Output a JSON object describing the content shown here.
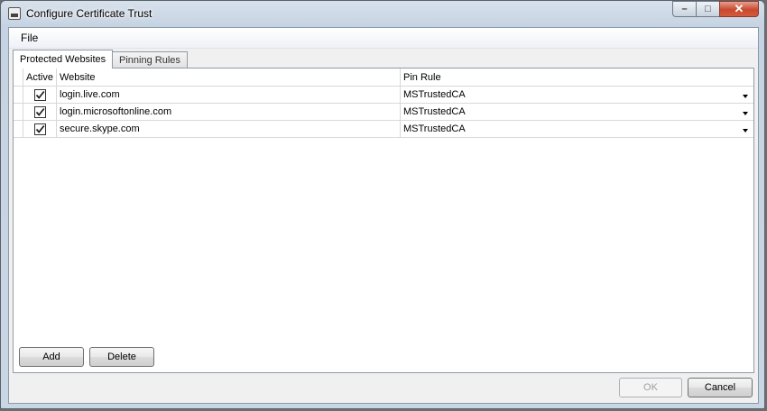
{
  "window": {
    "title": "Configure Certificate Trust"
  },
  "menu": {
    "file_label": "File"
  },
  "tabs": [
    {
      "label": "Protected Websites",
      "active": true
    },
    {
      "label": "Pinning Rules",
      "active": false
    }
  ],
  "grid": {
    "columns": {
      "active": "Active",
      "website": "Website",
      "pin_rule": "Pin Rule"
    },
    "rows": [
      {
        "active": true,
        "website": "login.live.com",
        "pin_rule": "MSTrustedCA"
      },
      {
        "active": true,
        "website": "login.microsoftonline.com",
        "pin_rule": "MSTrustedCA"
      },
      {
        "active": true,
        "website": "secure.skype.com",
        "pin_rule": "MSTrustedCA"
      }
    ]
  },
  "buttons": {
    "add": "Add",
    "delete": "Delete",
    "ok": "OK",
    "cancel": "Cancel"
  },
  "window_controls": {
    "minimize": "–",
    "maximize": "□",
    "close": "✕"
  }
}
